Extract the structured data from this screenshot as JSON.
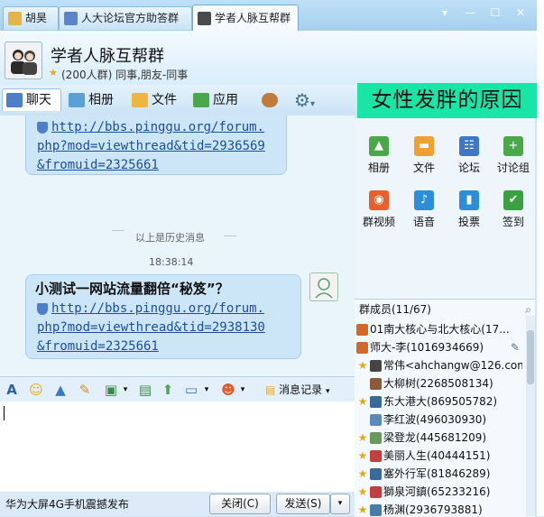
{
  "tabs": [
    {
      "label": "胡昊",
      "color": "#e6b34a"
    },
    {
      "label": "人大论坛官方助答群",
      "color": "#5a86c9"
    },
    {
      "label": "学者人脉互帮群",
      "color": "#4b4b4b"
    }
  ],
  "group": {
    "title": "学者人脉互帮群",
    "subtitle": "(200人群) 同事,朋友-同事"
  },
  "toolbar": {
    "chat": "聊天",
    "album": "相册",
    "file": "文件",
    "app": "应用"
  },
  "overlay_text": "女性发胖的原因",
  "chat": {
    "msg1_link_lines": [
      "http://bbs.pinggu.org/forum.",
      "php?mod=viewthread&tid=2936569",
      "&fromuid=2325661"
    ],
    "history_label": "以上是历史消息",
    "timestamp": "18:38:14",
    "msg2_title": "小测试一网站流量翻倍“秘笈”？",
    "msg2_link_lines": [
      "http://bbs.pinggu.org/forum.",
      "php?mod=viewthread&tid=2938130",
      "&fromuid=2325661"
    ]
  },
  "input_toolbar": {
    "history": "消息记录"
  },
  "bottom": {
    "ad": "华为大屏4G手机震撼发布",
    "close": "关闭(C)",
    "send": "发送(S)"
  },
  "apps": [
    {
      "label": "相册",
      "icon": "photo-icon",
      "color": "#4aa84a",
      "glyph": "▲"
    },
    {
      "label": "文件",
      "icon": "folder-icon",
      "color": "#f0a030",
      "glyph": "▬"
    },
    {
      "label": "论坛",
      "icon": "forum-icon",
      "color": "#3b78c8",
      "glyph": "☷"
    },
    {
      "label": "讨论组",
      "icon": "discussion-icon",
      "color": "#4aa84a",
      "glyph": "+"
    },
    {
      "label": "群视频",
      "icon": "video-icon",
      "color": "#e8602c",
      "glyph": "◉"
    },
    {
      "label": "语音",
      "icon": "voice-icon",
      "color": "#2c8ed8",
      "glyph": "♪"
    },
    {
      "label": "投票",
      "icon": "vote-icon",
      "color": "#2c8ed8",
      "glyph": "▮"
    },
    {
      "label": "签到",
      "icon": "checkin-icon",
      "color": "#3aa040",
      "glyph": "✔"
    }
  ],
  "members_header": "群成员(11/67)",
  "members": [
    {
      "name": "01南大核心与北大核心(17...",
      "star": "",
      "color": "#d2692a"
    },
    {
      "name": "师大-李(1016934669)",
      "star": "",
      "color": "#d2692a"
    },
    {
      "name": "常伟<ahchangw@126.com>",
      "star": "★",
      "color": "#444444"
    },
    {
      "name": "大柳树(2268508134)",
      "star": "",
      "color": "#8a5a3a"
    },
    {
      "name": "东大港大(869505782)",
      "star": "★",
      "color": "#3a6a9a"
    },
    {
      "name": "李红波(496030930)",
      "star": "",
      "color": "#5a8ab8"
    },
    {
      "name": "梁登龙(445681209)",
      "star": "★",
      "color": "#6a9a5a"
    },
    {
      "name": "美丽人生(40444151)",
      "star": "★",
      "color": "#c04040"
    },
    {
      "name": "塞外行军(81846289)",
      "star": "★",
      "color": "#3a6a9a"
    },
    {
      "name": "獅泉河鎮(65233216)",
      "star": "★",
      "color": "#c04040"
    },
    {
      "name": "杨渊(2936793881)",
      "star": "★",
      "color": "#4a7aa8"
    }
  ]
}
